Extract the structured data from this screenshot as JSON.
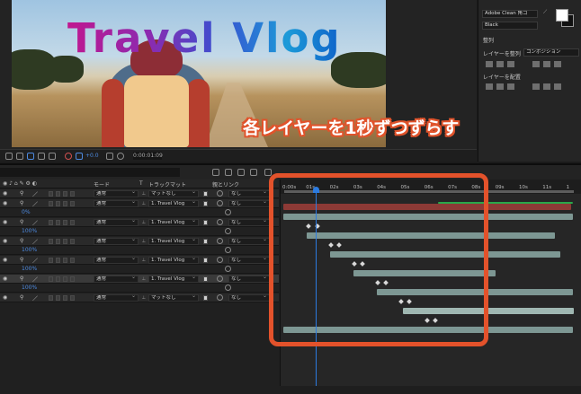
{
  "composition": {
    "title_text": "Travel Vlog"
  },
  "viewer_bar": {
    "zoom": "+0.0",
    "timecode": "0:00:01:09"
  },
  "right_panel": {
    "font_family": "Adobe Clean 角ゴ",
    "font_style": "Black",
    "align_label": "整列",
    "align_to_label": "レイヤーを整列",
    "align_to_value": "コンポジション",
    "distribute_label": "レイヤーを配置"
  },
  "annotation": "各レイヤーを1秒ずつずらす",
  "timeline": {
    "headers": {
      "mode": "モード",
      "t": "T",
      "track_matte": "トラックマット",
      "parent": "親とリンク"
    },
    "layers": [
      {
        "num": "",
        "mode": "通常",
        "matte": "マットなし",
        "parent": "なし",
        "opacity": ""
      },
      {
        "num": "",
        "mode": "通常",
        "matte": "1. Travel Vlog",
        "parent": "なし",
        "opacity": "0%"
      },
      {
        "num": "",
        "mode": "通常",
        "matte": "1. Travel Vlog",
        "parent": "なし",
        "opacity": "100%"
      },
      {
        "num": "",
        "mode": "通常",
        "matte": "1. Travel Vlog",
        "parent": "なし",
        "opacity": "100%"
      },
      {
        "num": "",
        "mode": "通常",
        "matte": "1. Travel Vlog",
        "parent": "なし",
        "opacity": "100%"
      },
      {
        "num": "",
        "mode": "通常",
        "matte": "1. Travel Vlog",
        "parent": "なし",
        "opacity": "100%"
      },
      {
        "num": "",
        "mode": "通常",
        "matte": "マットなし",
        "parent": "なし",
        "opacity": ""
      }
    ],
    "ruler_ticks": [
      "0:00s",
      "01s",
      "02s",
      "03s",
      "04s",
      "05s",
      "06s",
      "07s",
      "08s",
      "09s",
      "10s",
      "11s",
      "1"
    ],
    "colors": {
      "red_bar": "#8d3a36",
      "teal_bar": "#7d9793",
      "cti": "#2c7be0",
      "highlight": "#e3522b",
      "green": "#2aa84a"
    }
  }
}
